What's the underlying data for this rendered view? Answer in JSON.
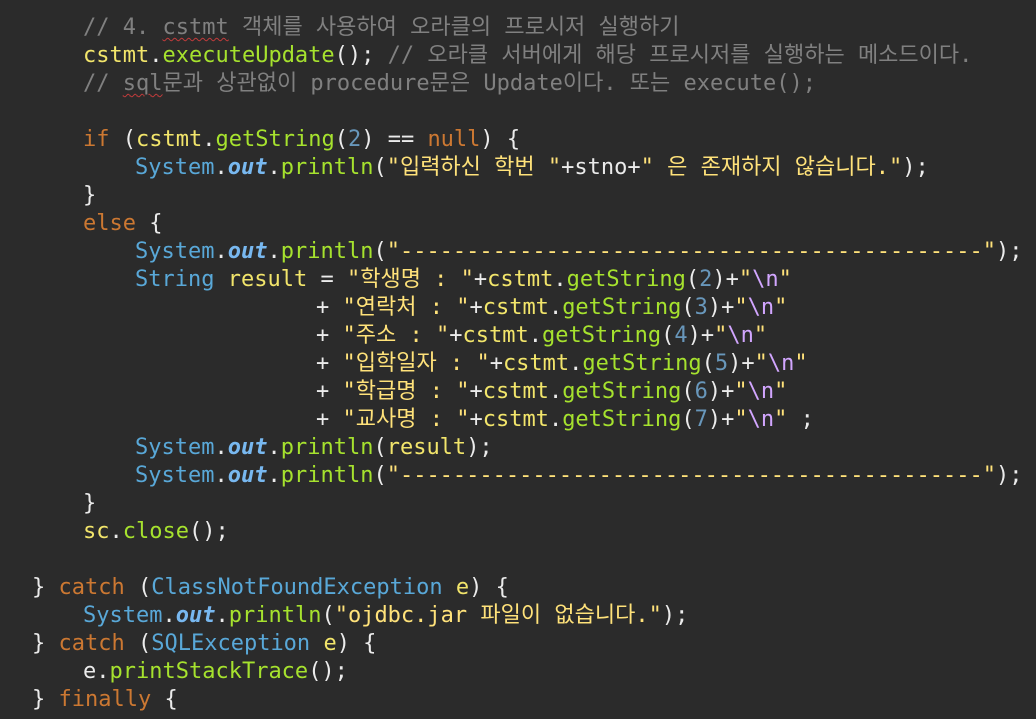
{
  "editor": {
    "lines": [
      [
        {
          "t": "cm",
          "v": "// 4. "
        },
        {
          "t": "cm",
          "v": "cstmt",
          "s": 1
        },
        {
          "t": "cm",
          "v": " 객체를 사용하여 오라클의 프로시저 실행하기"
        }
      ],
      [
        {
          "t": "var",
          "v": "cstmt"
        },
        {
          "t": "pln",
          "v": "."
        },
        {
          "t": "mth",
          "v": "executeUpdate"
        },
        {
          "t": "pln",
          "v": "(); "
        },
        {
          "t": "cm",
          "v": "// 오라클 서버에게 해당 프로시저를 실행하는 메소드이다."
        }
      ],
      [
        {
          "t": "cm",
          "v": "// "
        },
        {
          "t": "cm",
          "v": "sql",
          "s": 1
        },
        {
          "t": "cm",
          "v": "문과 상관없이 procedure문은 Update이다. 또는 execute();"
        }
      ],
      [],
      [
        {
          "t": "kw",
          "v": "if"
        },
        {
          "t": "pln",
          "v": " ("
        },
        {
          "t": "var",
          "v": "cstmt"
        },
        {
          "t": "pln",
          "v": "."
        },
        {
          "t": "mth",
          "v": "getString"
        },
        {
          "t": "pln",
          "v": "("
        },
        {
          "t": "num",
          "v": "2"
        },
        {
          "t": "pln",
          "v": ") == "
        },
        {
          "t": "kw",
          "v": "null"
        },
        {
          "t": "pln",
          "v": ") {"
        }
      ],
      [
        {
          "t": "cls",
          "v": "System"
        },
        {
          "t": "pln",
          "v": "."
        },
        {
          "t": "fld",
          "v": "out"
        },
        {
          "t": "pln",
          "v": "."
        },
        {
          "t": "mth",
          "v": "println"
        },
        {
          "t": "pln",
          "v": "("
        },
        {
          "t": "str",
          "v": "\"입력하신 학번 \""
        },
        {
          "t": "pln",
          "v": "+stno+"
        },
        {
          "t": "str",
          "v": "\" 은 존재하지 않습니다.\""
        },
        {
          "t": "pln",
          "v": ");"
        }
      ],
      [
        {
          "t": "pln",
          "v": "}"
        }
      ],
      [
        {
          "t": "kw",
          "v": "else"
        },
        {
          "t": "pln",
          "v": " {"
        }
      ],
      [
        {
          "t": "cls",
          "v": "System"
        },
        {
          "t": "pln",
          "v": "."
        },
        {
          "t": "fld",
          "v": "out"
        },
        {
          "t": "pln",
          "v": "."
        },
        {
          "t": "mth",
          "v": "println"
        },
        {
          "t": "pln",
          "v": "("
        },
        {
          "t": "str",
          "v": "\"--------------------------------------------\""
        },
        {
          "t": "pln",
          "v": ");"
        }
      ],
      [
        {
          "t": "cls",
          "v": "String"
        },
        {
          "t": "pln",
          "v": " "
        },
        {
          "t": "var",
          "v": "result"
        },
        {
          "t": "pln",
          "v": " = "
        },
        {
          "t": "str",
          "v": "\"학생명 : \""
        },
        {
          "t": "pln",
          "v": "+"
        },
        {
          "t": "var",
          "v": "cstmt"
        },
        {
          "t": "pln",
          "v": "."
        },
        {
          "t": "mth",
          "v": "getString"
        },
        {
          "t": "pln",
          "v": "("
        },
        {
          "t": "num",
          "v": "2"
        },
        {
          "t": "pln",
          "v": ")+"
        },
        {
          "t": "str",
          "v": "\""
        },
        {
          "t": "esc",
          "v": "\\n"
        },
        {
          "t": "str",
          "v": "\""
        }
      ],
      [
        {
          "t": "pln",
          "v": "+ "
        },
        {
          "t": "str",
          "v": "\"연락처 : \""
        },
        {
          "t": "pln",
          "v": "+"
        },
        {
          "t": "var",
          "v": "cstmt"
        },
        {
          "t": "pln",
          "v": "."
        },
        {
          "t": "mth",
          "v": "getString"
        },
        {
          "t": "pln",
          "v": "("
        },
        {
          "t": "num",
          "v": "3"
        },
        {
          "t": "pln",
          "v": ")+"
        },
        {
          "t": "str",
          "v": "\""
        },
        {
          "t": "esc",
          "v": "\\n"
        },
        {
          "t": "str",
          "v": "\""
        }
      ],
      [
        {
          "t": "pln",
          "v": "+ "
        },
        {
          "t": "str",
          "v": "\"주소 : \""
        },
        {
          "t": "pln",
          "v": "+"
        },
        {
          "t": "var",
          "v": "cstmt"
        },
        {
          "t": "pln",
          "v": "."
        },
        {
          "t": "mth",
          "v": "getString"
        },
        {
          "t": "pln",
          "v": "("
        },
        {
          "t": "num",
          "v": "4"
        },
        {
          "t": "pln",
          "v": ")+"
        },
        {
          "t": "str",
          "v": "\""
        },
        {
          "t": "esc",
          "v": "\\n"
        },
        {
          "t": "str",
          "v": "\""
        }
      ],
      [
        {
          "t": "pln",
          "v": "+ "
        },
        {
          "t": "str",
          "v": "\"입학일자 : \""
        },
        {
          "t": "pln",
          "v": "+"
        },
        {
          "t": "var",
          "v": "cstmt"
        },
        {
          "t": "pln",
          "v": "."
        },
        {
          "t": "mth",
          "v": "getString"
        },
        {
          "t": "pln",
          "v": "("
        },
        {
          "t": "num",
          "v": "5"
        },
        {
          "t": "pln",
          "v": ")+"
        },
        {
          "t": "str",
          "v": "\""
        },
        {
          "t": "esc",
          "v": "\\n"
        },
        {
          "t": "str",
          "v": "\""
        }
      ],
      [
        {
          "t": "pln",
          "v": "+ "
        },
        {
          "t": "str",
          "v": "\"학급명 : \""
        },
        {
          "t": "pln",
          "v": "+"
        },
        {
          "t": "var",
          "v": "cstmt"
        },
        {
          "t": "pln",
          "v": "."
        },
        {
          "t": "mth",
          "v": "getString"
        },
        {
          "t": "pln",
          "v": "("
        },
        {
          "t": "num",
          "v": "6"
        },
        {
          "t": "pln",
          "v": ")+"
        },
        {
          "t": "str",
          "v": "\""
        },
        {
          "t": "esc",
          "v": "\\n"
        },
        {
          "t": "str",
          "v": "\""
        }
      ],
      [
        {
          "t": "pln",
          "v": "+ "
        },
        {
          "t": "str",
          "v": "\"교사명 : \""
        },
        {
          "t": "pln",
          "v": "+"
        },
        {
          "t": "var",
          "v": "cstmt"
        },
        {
          "t": "pln",
          "v": "."
        },
        {
          "t": "mth",
          "v": "getString"
        },
        {
          "t": "pln",
          "v": "("
        },
        {
          "t": "num",
          "v": "7"
        },
        {
          "t": "pln",
          "v": ")+"
        },
        {
          "t": "str",
          "v": "\""
        },
        {
          "t": "esc",
          "v": "\\n"
        },
        {
          "t": "str",
          "v": "\""
        },
        {
          "t": "pln",
          "v": " ;"
        }
      ],
      [
        {
          "t": "cls",
          "v": "System"
        },
        {
          "t": "pln",
          "v": "."
        },
        {
          "t": "fld",
          "v": "out"
        },
        {
          "t": "pln",
          "v": "."
        },
        {
          "t": "mth",
          "v": "println"
        },
        {
          "t": "pln",
          "v": "("
        },
        {
          "t": "var",
          "v": "result"
        },
        {
          "t": "pln",
          "v": ");"
        }
      ],
      [
        {
          "t": "cls",
          "v": "System"
        },
        {
          "t": "pln",
          "v": "."
        },
        {
          "t": "fld",
          "v": "out"
        },
        {
          "t": "pln",
          "v": "."
        },
        {
          "t": "mth",
          "v": "println"
        },
        {
          "t": "pln",
          "v": "("
        },
        {
          "t": "str",
          "v": "\"--------------------------------------------\""
        },
        {
          "t": "pln",
          "v": ");"
        }
      ],
      [
        {
          "t": "pln",
          "v": "}"
        }
      ],
      [
        {
          "t": "var",
          "v": "sc"
        },
        {
          "t": "pln",
          "v": "."
        },
        {
          "t": "mth",
          "v": "close"
        },
        {
          "t": "pln",
          "v": "();"
        }
      ],
      [],
      [
        {
          "t": "pln",
          "v": "} "
        },
        {
          "t": "kw",
          "v": "catch"
        },
        {
          "t": "pln",
          "v": " ("
        },
        {
          "t": "cls",
          "v": "ClassNotFoundException"
        },
        {
          "t": "pln",
          "v": " "
        },
        {
          "t": "var",
          "v": "e"
        },
        {
          "t": "pln",
          "v": ") {"
        }
      ],
      [
        {
          "t": "cls",
          "v": "System"
        },
        {
          "t": "pln",
          "v": "."
        },
        {
          "t": "fld",
          "v": "out"
        },
        {
          "t": "pln",
          "v": "."
        },
        {
          "t": "mth",
          "v": "println"
        },
        {
          "t": "pln",
          "v": "("
        },
        {
          "t": "str",
          "v": "\"ojdbc.jar 파일이 없습니다.\""
        },
        {
          "t": "pln",
          "v": ");"
        }
      ],
      [
        {
          "t": "pln",
          "v": "} "
        },
        {
          "t": "kw",
          "v": "catch"
        },
        {
          "t": "pln",
          "v": " ("
        },
        {
          "t": "cls",
          "v": "SQLException"
        },
        {
          "t": "pln",
          "v": " "
        },
        {
          "t": "var",
          "v": "e"
        },
        {
          "t": "pln",
          "v": ") {"
        }
      ],
      [
        {
          "t": "pln",
          "v": "e."
        },
        {
          "t": "mth",
          "v": "printStackTrace"
        },
        {
          "t": "pln",
          "v": "();"
        }
      ],
      [
        {
          "t": "pln",
          "v": "} "
        },
        {
          "t": "kw",
          "v": "finally"
        },
        {
          "t": "pln",
          "v": " {"
        }
      ]
    ]
  }
}
